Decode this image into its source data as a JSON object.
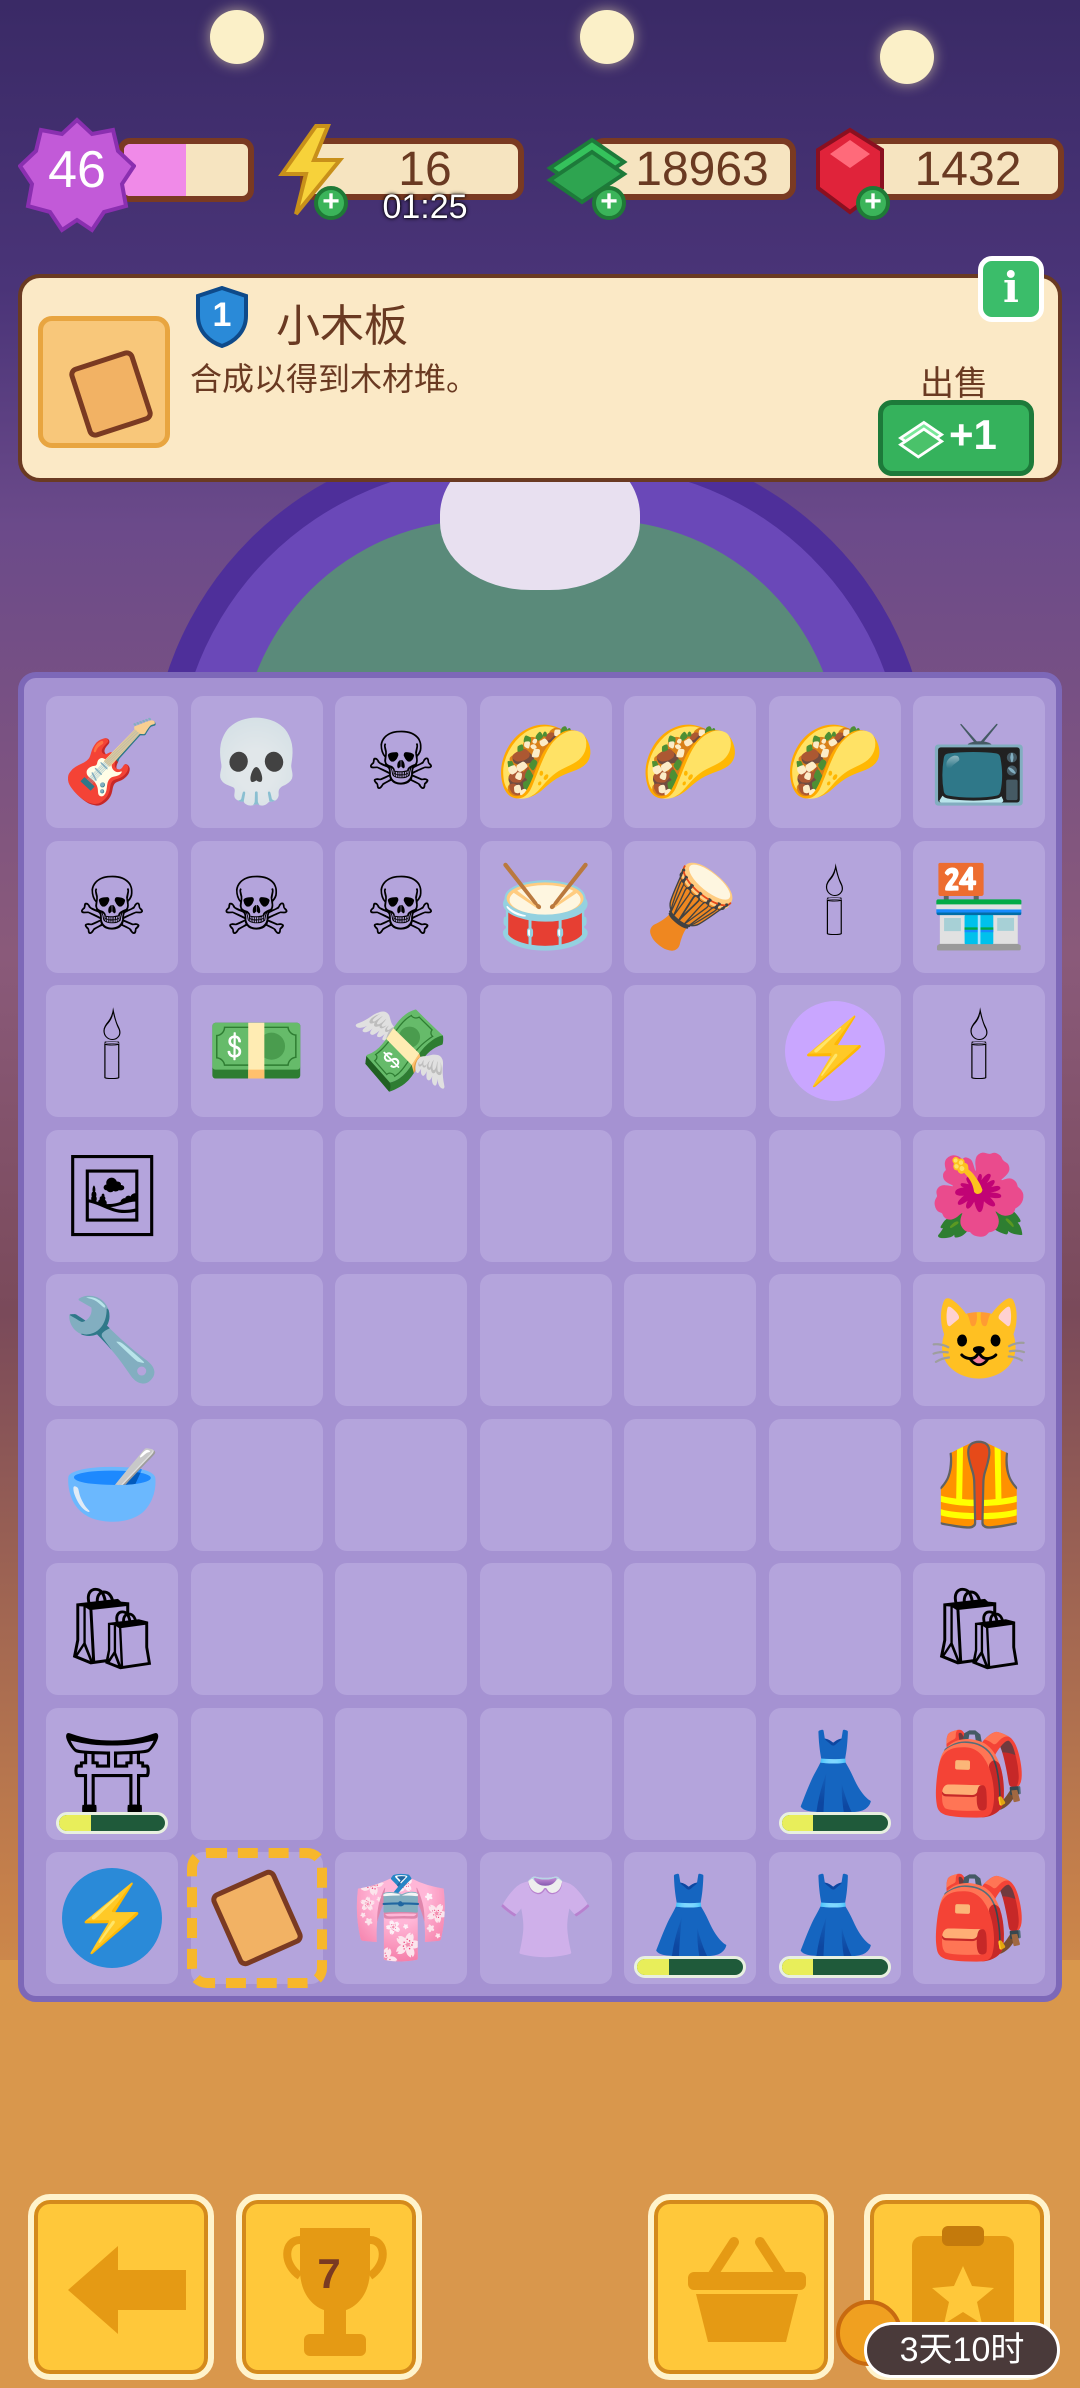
{
  "hud": {
    "level": "46",
    "xp_progress": 0.5,
    "energy": "16",
    "energy_timer": "01:25",
    "cash": "18963",
    "gems": "1432"
  },
  "info_panel": {
    "item_level": "1",
    "item_name": "小木板",
    "item_desc": "合成以得到木材堆。",
    "sell_label": "出售",
    "sell_value": "+1"
  },
  "board": {
    "rows": [
      [
        "mariachi-skeleton",
        "skeleton-chef",
        "papel-picado",
        "taco-cart",
        "taco-cart",
        "taco-cart",
        "retro-tv"
      ],
      [
        "papel-picado",
        "papel-picado",
        "papel-picado",
        "drum",
        "bass-drum",
        "candle-basket",
        "shop-building"
      ],
      [
        "candle-basket",
        "cash-stack",
        "cash-pile",
        "",
        "",
        "energy-orb",
        "candle-basket"
      ],
      [
        "portrait-wreath",
        "",
        "",
        "",
        "",
        "",
        "flower-crown"
      ],
      [
        "pipe",
        "",
        "",
        "",
        "",
        "",
        "skull-charm"
      ],
      [
        "wooden-bowl",
        "",
        "",
        "",
        "",
        "",
        "embroidered-vest"
      ],
      [
        "gift-bag",
        "",
        "",
        "",
        "",
        "",
        "gift-bag"
      ],
      [
        "altar",
        "",
        "",
        "",
        "",
        "dress",
        "rainbow-bag"
      ],
      [
        "energy-orb-blue",
        "wood-plank",
        "skirt",
        "blouse",
        "dress",
        "dress",
        "green-backpack"
      ]
    ],
    "progress": {
      "7-0": 0.3,
      "7-5": 0.3,
      "8-4": 0.3,
      "8-5": 0.3
    },
    "selected": "8-1"
  },
  "bottom_bar": {
    "trophy_count": "7",
    "event_timer": "3天10时"
  },
  "icons": {
    "mariachi-skeleton": "🎸",
    "skeleton-chef": "💀",
    "papel-picado": "☠",
    "taco-cart": "🌮",
    "retro-tv": "📺",
    "drum": "🥁",
    "bass-drum": "🪘",
    "candle-basket": "🕯",
    "shop-building": "🏪",
    "cash-stack": "💵",
    "cash-pile": "💸",
    "energy-orb": "⚡",
    "energy-orb-blue": "⚡",
    "portrait-wreath": "🖼",
    "flower-crown": "🌺",
    "pipe": "🔧",
    "skull-charm": "😺",
    "wooden-bowl": "🥣",
    "embroidered-vest": "🦺",
    "gift-bag": "🛍",
    "altar": "⛩",
    "dress": "👗",
    "rainbow-bag": "🎒",
    "wood-plank": "",
    "skirt": "👘",
    "blouse": "👚",
    "green-backpack": "🎒"
  },
  "colors": {
    "cash_green": "#35b25c",
    "gem_red": "#e0233a",
    "energy_yellow": "#f7d23a",
    "xp_pink": "#f08ae8",
    "board_purple": "#a592d2",
    "button_yellow": "#ffc83a"
  }
}
